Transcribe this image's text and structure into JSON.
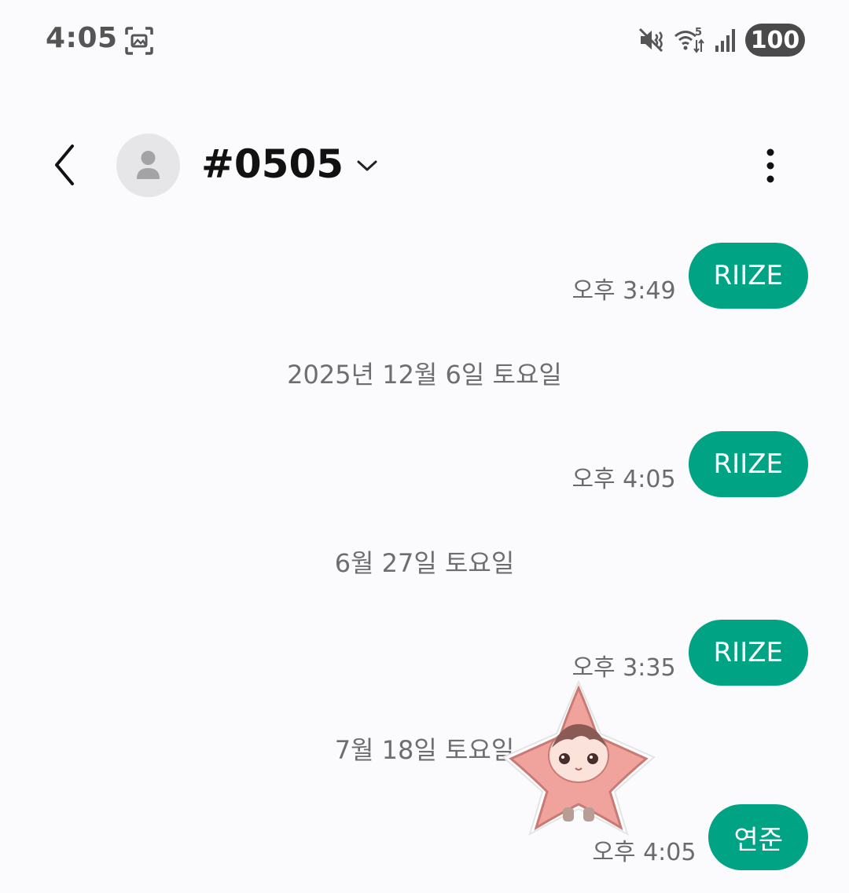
{
  "status_bar": {
    "time": "4:05",
    "battery": "100",
    "icons": [
      "screenshot-icon",
      "mute-vibrate-icon",
      "wifi-5ghz-icon",
      "signal-icon",
      "battery-icon"
    ]
  },
  "header": {
    "contact_name": "#0505",
    "icons": [
      "back-arrow-icon",
      "person-avatar-icon",
      "chevron-down-icon",
      "more-vertical-icon"
    ]
  },
  "conversation": [
    {
      "type": "message",
      "text": "RIIZE",
      "time": "오후 3:49"
    },
    {
      "type": "date",
      "text": "2025년 12월 6일 토요일"
    },
    {
      "type": "message",
      "text": "RIIZE",
      "time": "오후 4:05"
    },
    {
      "type": "date",
      "text": "6월 27일 토요일"
    },
    {
      "type": "message",
      "text": "RIIZE",
      "time": "오후 3:35"
    },
    {
      "type": "date",
      "text": "7월 18일 토요일"
    },
    {
      "type": "message",
      "text": "연준",
      "time": "오후 4:05"
    }
  ],
  "colors": {
    "bubble": "#00a384",
    "background": "#fbfbfd",
    "sticker": "#f0a29c"
  },
  "sticker": {
    "icon": "starfish-character-sticker"
  }
}
